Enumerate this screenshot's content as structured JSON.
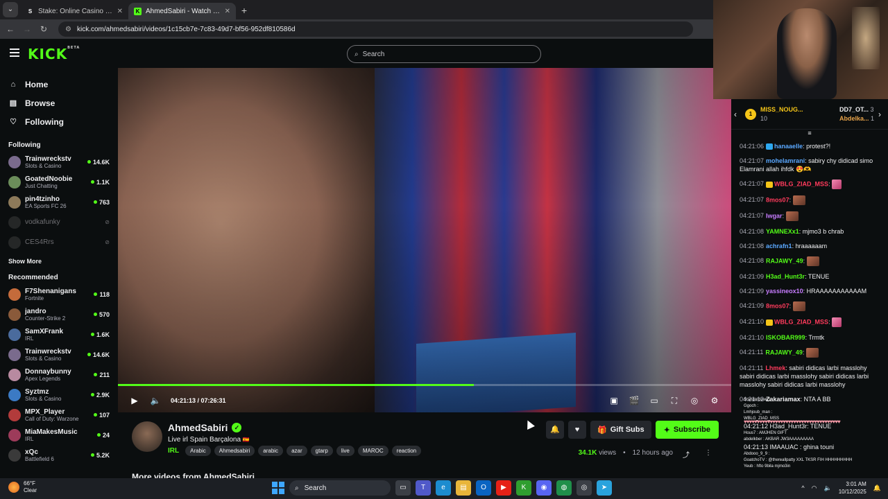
{
  "browser": {
    "tabs": [
      {
        "title": "Stake: Online Casino & Sports B",
        "active": false
      },
      {
        "title": "AhmedSabiri - Watch the VOD",
        "active": true
      }
    ],
    "url": "kick.com/ahmedsabiri/videos/1c15cb7e-7c83-49d7-bf56-952df810586d"
  },
  "header": {
    "logo": "KICK",
    "logo_badge": "BETA",
    "search_placeholder": "Search"
  },
  "sidebar": {
    "nav": [
      {
        "label": "Home",
        "icon": "home-icon"
      },
      {
        "label": "Browse",
        "icon": "browse-icon"
      },
      {
        "label": "Following",
        "icon": "heart-icon"
      }
    ],
    "following_title": "Following",
    "following": [
      {
        "name": "Trainwreckstv",
        "category": "Slots & Casino",
        "viewers": "14.6K",
        "live": true
      },
      {
        "name": "GoatedNoobie",
        "category": "Just Chatting",
        "viewers": "1.1K",
        "live": true
      },
      {
        "name": "pin4tzinho",
        "category": "EA Sports FC 26",
        "viewers": "763",
        "live": true
      },
      {
        "name": "vodkafunky",
        "category": "",
        "viewers": "",
        "live": false
      },
      {
        "name": "CES4Rrs",
        "category": "",
        "viewers": "",
        "live": false
      }
    ],
    "show_more": "Show More",
    "recommended_title": "Recommended",
    "recommended": [
      {
        "name": "F7Shenanigans",
        "category": "Fortnite",
        "viewers": "118"
      },
      {
        "name": "jandro",
        "category": "Counter-Strike 2",
        "viewers": "570"
      },
      {
        "name": "SamXFrank",
        "category": "IRL",
        "viewers": "1.6K"
      },
      {
        "name": "Trainwreckstv",
        "category": "Slots & Casino",
        "viewers": "14.6K"
      },
      {
        "name": "Donnaybunny",
        "category": "Apex Legends",
        "viewers": "211"
      },
      {
        "name": "Syztmz",
        "category": "Slots & Casino",
        "viewers": "2.9K"
      },
      {
        "name": "MPX_Player",
        "category": "Call of Duty: Warzone",
        "viewers": "107"
      },
      {
        "name": "MiaMakesMusic",
        "category": "IRL",
        "viewers": "24"
      },
      {
        "name": "xQc",
        "category": "Battlefield 6",
        "viewers": "5.2K"
      }
    ]
  },
  "player": {
    "time": "04:21:13 / 07:26:31",
    "progress": 0.58
  },
  "stream": {
    "streamer": "AhmedSabiri",
    "title": "Live irl Spain Barçalona",
    "flag": "🇪🇸",
    "category": "IRL",
    "tags": [
      "Arabic",
      "Ahmedsabiri",
      "arabic",
      "azar",
      "gtarp",
      "live",
      "MAROC",
      "reaction"
    ],
    "gift_label": "Gift Subs",
    "subscribe_label": "Subscribe",
    "views_count": "34.1K",
    "views_label": "views",
    "ago": "12 hours ago",
    "more_videos": "More videos from AhmedSabiri"
  },
  "chat": {
    "top": [
      {
        "name": "MISS_NOUG...",
        "count": "10"
      },
      {
        "name": "DD7_OT...",
        "count": "3"
      },
      {
        "name": "Abdelka...",
        "count": "1"
      }
    ],
    "messages": [
      {
        "ts": "04:21:06",
        "user": "hanaaelle",
        "color": "#5aa8ff",
        "text": "protest?!"
      },
      {
        "ts": "04:21:07",
        "user": "mohelamrani",
        "color": "#5aa8ff",
        "text": "sabiry chy didicad simo Elamrani allah ihfdk 😍🫶"
      },
      {
        "ts": "04:21:07",
        "user": "WBLG_ZIAD_MSS",
        "color": "#ff3b5c",
        "text": ""
      },
      {
        "ts": "04:21:07",
        "user": "8mos07",
        "color": "#ff3b5c",
        "text": ""
      },
      {
        "ts": "04:21:07",
        "user": "Iwgar",
        "color": "#c77dff",
        "text": ""
      },
      {
        "ts": "04:21:08",
        "user": "YAMNEXx1",
        "color": "#53fc18",
        "text": "mjmo3 b chrab"
      },
      {
        "ts": "04:21:08",
        "user": "achrafn1",
        "color": "#5aa8ff",
        "text": "hraaaaaam"
      },
      {
        "ts": "04:21:08",
        "user": "RAJAWY_49",
        "color": "#53fc18",
        "text": ""
      },
      {
        "ts": "04:21:09",
        "user": "H3ad_Hunt3r",
        "color": "#53fc18",
        "text": "TENUE"
      },
      {
        "ts": "04:21:09",
        "user": "yassineox10",
        "color": "#c77dff",
        "text": "HRAAAAAAAAAAAM"
      },
      {
        "ts": "04:21:09",
        "user": "8mos07",
        "color": "#ff3b5c",
        "text": ""
      },
      {
        "ts": "04:21:10",
        "user": "WBLG_ZIAD_MSS",
        "color": "#ff3b5c",
        "text": ""
      },
      {
        "ts": "04:21:10",
        "user": "ISKOBAR999",
        "color": "#53fc18",
        "text": "Trmtk"
      },
      {
        "ts": "04:21:11",
        "user": "RAJAWY_49",
        "color": "#53fc18",
        "text": ""
      },
      {
        "ts": "04:21:11",
        "user": "Lhmek",
        "color": "#ff3b5c",
        "text": "sabiri didicas larbi masslohy sabiri didicas larbi masslohy sabiri didicas larbi masslohy sabiri didicas larbi masslohy"
      },
      {
        "ts": "04:21:12",
        "user": "Zakariamax",
        "color": "#efeff1",
        "text": "NTA A BB"
      }
    ],
    "overlay": [
      "Standardown1 :",
      "Ggoch :",
      "Lmhjoub_man :",
      "WBLG_ZIAD_MSS",
      "04:21:12 H3ad_Hunt3r: TENUE",
      "Hous7 : AMJHEN GIFT",
      "abdelkber : AKBAR JW3AAAAAAAAA",
      "04:21:13 IMAAUAC : ghina touni",
      "Abdooo_9_9 :",
      "GoatchoTV : @thereallpatty XXL TKSR FIH HHHHHHHHH",
      "Yeub : hfto 9bila mjmo3in"
    ]
  },
  "taskbar": {
    "temp": "66°F",
    "weather": "Clear",
    "search": "Search",
    "time": "3:01 AM",
    "date": "10/12/2025"
  }
}
